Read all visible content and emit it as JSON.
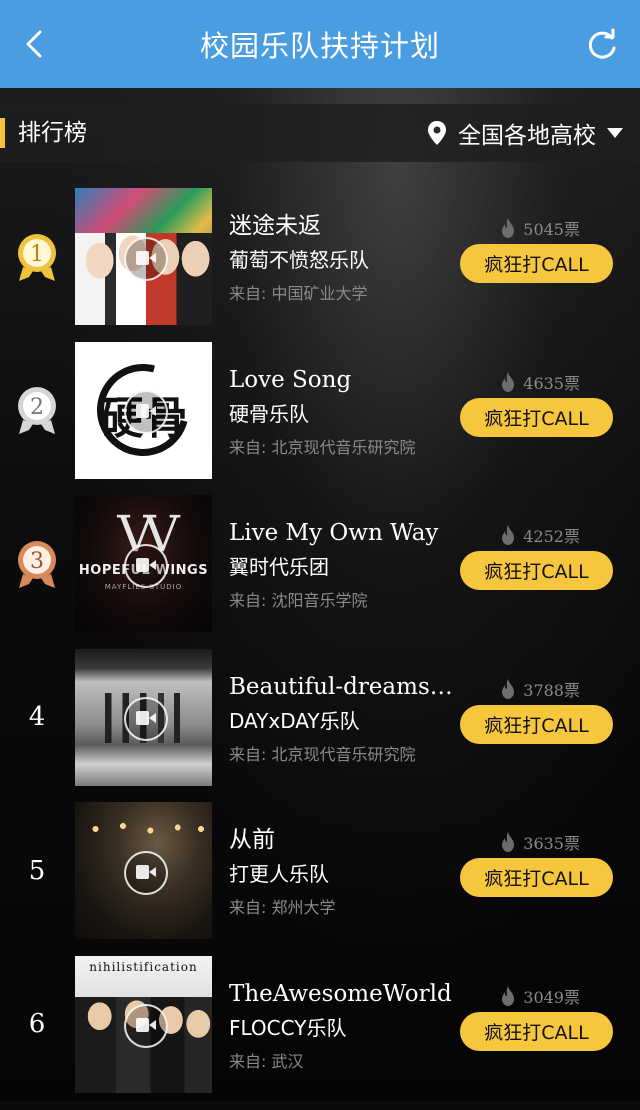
{
  "header": {
    "title": "校园乐队扶持计划",
    "back_icon": "chevron-left-icon",
    "refresh_icon": "refresh-icon",
    "bg_color": "#4a9de0"
  },
  "filter": {
    "ranking_label": "排行榜",
    "region_label": "全国各地高校",
    "pin_icon": "location-pin-icon",
    "caret_icon": "caret-down-icon",
    "accent_color": "#f3c23a"
  },
  "call_button_label": "疯狂打CALL",
  "button_color": "#f6c63d",
  "entries": [
    {
      "rank": "1",
      "medal": "gold",
      "song": "迷途未返",
      "band": "葡萄不愤怒乐队",
      "school": "来自: 中国矿业大学",
      "votes": "5045票"
    },
    {
      "rank": "2",
      "medal": "silver",
      "song": "Love Song",
      "band": "硬骨乐队",
      "school": "来自: 北京现代音乐研究院",
      "votes": "4635票",
      "thumb_text": "硬骨"
    },
    {
      "rank": "3",
      "medal": "bronze",
      "song": "Live My Own Way",
      "band": "翼时代乐团",
      "school": "来自: 沈阳音乐学院",
      "votes": "4252票",
      "thumb_text": "HOPEFUL WINGS",
      "thumb_studio": "MAYFLIES STUDIO"
    },
    {
      "rank": "4",
      "medal": "none",
      "song": "Beautiful-dreams(Demo)",
      "band": "DAYxDAY乐队",
      "school": "来自: 北京现代音乐研究院",
      "votes": "3788票"
    },
    {
      "rank": "5",
      "medal": "none",
      "song": "从前",
      "band": "打更人乐队",
      "school": "来自: 郑州大学",
      "votes": "3635票"
    },
    {
      "rank": "6",
      "medal": "none",
      "song": "TheAwesomeWorld",
      "band": "FLOCCY乐队",
      "school": "来自: 武汉",
      "votes": "3049票",
      "thumb_text": "nihilistification"
    }
  ]
}
